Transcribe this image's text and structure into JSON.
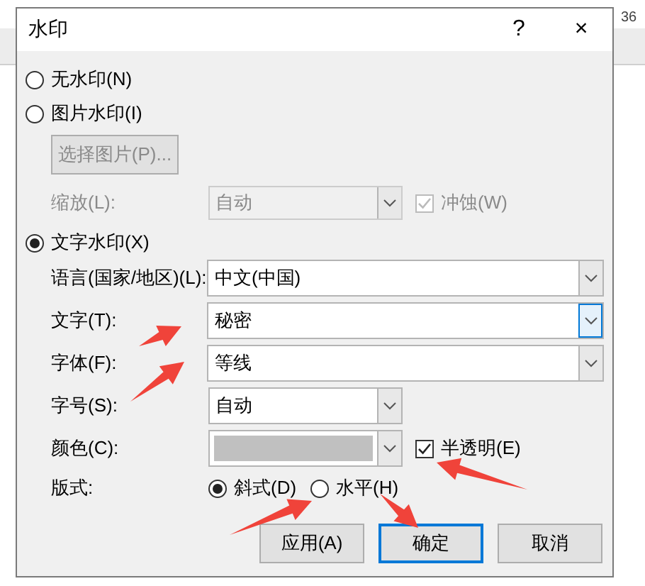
{
  "background": {
    "page_number": "36"
  },
  "dialog": {
    "title": "水印",
    "help": "?",
    "close": "×",
    "no_watermark": {
      "label": "无水印(N)",
      "selected": false
    },
    "picture_watermark": {
      "label": "图片水印(I)",
      "selected": false,
      "select_button": "选择图片(P)...",
      "scale_label": "缩放(L):",
      "scale_value": "自动",
      "washout": {
        "label": "冲蚀(W)",
        "checked": true
      },
      "disabled": true
    },
    "text_watermark": {
      "label": "文字水印(X)",
      "selected": true
    },
    "fields": [
      {
        "kind": "wide",
        "label": "语言(国家/地区)(L):",
        "value": "中文(中国)",
        "focused": false
      },
      {
        "kind": "wide",
        "label": "文字(T):",
        "value": "秘密",
        "focused": true
      },
      {
        "kind": "wide",
        "label": "字体(F):",
        "value": "等线",
        "focused": false
      },
      {
        "kind": "narrow",
        "label": "字号(S):",
        "value": "自动",
        "focused": false
      },
      {
        "kind": "color",
        "label": "颜色(C):",
        "color": "#c0c0c0",
        "focused": false,
        "checkbox": {
          "label": "半透明(E)",
          "checked": true
        }
      }
    ],
    "layout": {
      "label": "版式:",
      "options": [
        {
          "label": "斜式(D)",
          "selected": true
        },
        {
          "label": "水平(H)",
          "selected": false
        }
      ]
    },
    "buttons": [
      {
        "label": "应用(A)",
        "default": false
      },
      {
        "label": "确定",
        "default": true
      },
      {
        "label": "取消",
        "default": false
      }
    ]
  }
}
